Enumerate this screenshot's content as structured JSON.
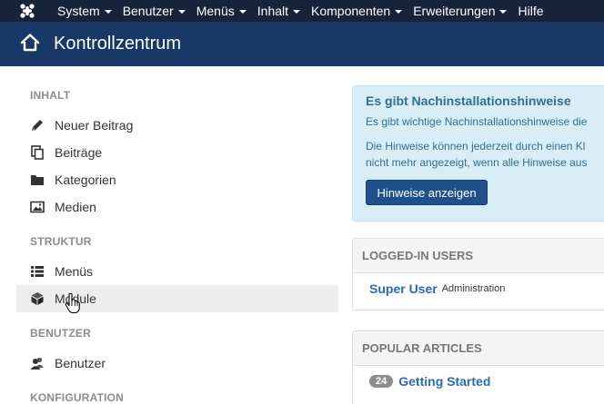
{
  "topbar": {
    "menu": [
      "System",
      "Benutzer",
      "Menüs",
      "Inhalt",
      "Komponenten",
      "Erweiterungen",
      "Hilfe"
    ]
  },
  "header": {
    "title": "Kontrollzentrum"
  },
  "sidebar": {
    "sections": [
      {
        "title": "INHALT",
        "items": [
          {
            "label": "Neuer Beitrag",
            "icon": "pencil-icon"
          },
          {
            "label": "Beiträge",
            "icon": "copy-icon"
          },
          {
            "label": "Kategorien",
            "icon": "folder-icon"
          },
          {
            "label": "Medien",
            "icon": "image-icon"
          }
        ]
      },
      {
        "title": "STRUKTUR",
        "items": [
          {
            "label": "Menüs",
            "icon": "list-icon"
          },
          {
            "label": "Module",
            "icon": "cube-icon",
            "active": true
          }
        ]
      },
      {
        "title": "BENUTZER",
        "items": [
          {
            "label": "Benutzer",
            "icon": "users-icon"
          }
        ]
      },
      {
        "title": "KONFIGURATION",
        "items": []
      }
    ]
  },
  "notice": {
    "title": "Es gibt Nachinstallationshinweise",
    "line1": "Es gibt wichtige Nachinstallationshinweise die",
    "line2": "Die Hinweise können jederzeit durch einen Kl",
    "line3": "nicht mehr angezeigt, wenn alle Hinweise aus",
    "button": "Hinweise anzeigen"
  },
  "logged_in": {
    "heading": "LOGGED-IN USERS",
    "user": "Super User",
    "role": "Administration"
  },
  "popular": {
    "heading": "POPULAR ARTICLES",
    "articles": [
      {
        "hits": "24",
        "title": "Getting Started"
      }
    ]
  },
  "colors": {
    "topbar": "#17223b",
    "header": "#1a3867",
    "link": "#2a6ab0",
    "notice_bg": "#d9edf7",
    "button": "#20508a"
  }
}
